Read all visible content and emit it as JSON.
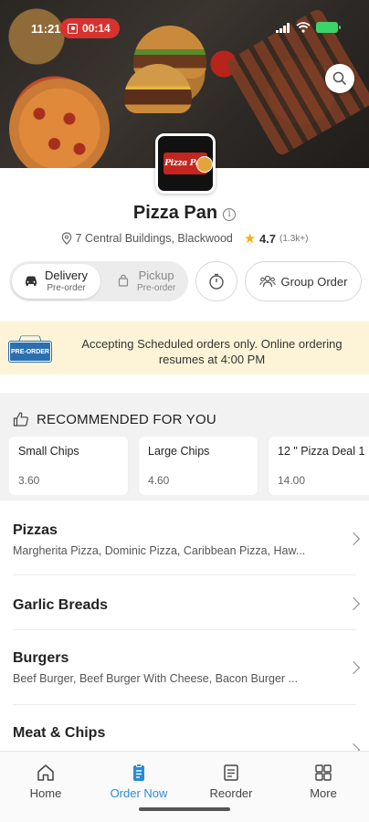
{
  "status_bar": {
    "time": "11:21",
    "recording": "00:14"
  },
  "restaurant": {
    "name": "Pizza Pan",
    "logo_text": "Pizza Pan",
    "address": "7 Central Buildings, Blackwood",
    "rating": "4.7",
    "rating_count": "(1.3k+)"
  },
  "order_mode": {
    "delivery_label": "Delivery",
    "delivery_sub": "Pre-order",
    "pickup_label": "Pickup",
    "pickup_sub": "Pre-order",
    "selected": "delivery",
    "group_order_label": "Group Order"
  },
  "banner": {
    "badge_text": "PRE-ORDER",
    "message": "Accepting Scheduled orders only. Online ordering resumes at 4:00 PM"
  },
  "recommended": {
    "title": "RECOMMENDED FOR YOU",
    "items": [
      {
        "name": "Small Chips",
        "price": "3.60"
      },
      {
        "name": "Large Chips",
        "price": "4.60"
      },
      {
        "name": "12 \" Pizza Deal 1",
        "price": "14.00"
      }
    ]
  },
  "categories": [
    {
      "name": "Pizzas",
      "desc": "Margherita Pizza, Dominic Pizza, Caribbean Pizza, Haw..."
    },
    {
      "name": "Garlic Breads",
      "desc": ""
    },
    {
      "name": "Burgers",
      "desc": "Beef Burger, Beef Burger With Cheese, Bacon Burger ..."
    },
    {
      "name": "Meat & Chips",
      "desc": ""
    }
  ],
  "bottom_nav": [
    {
      "label": "Home",
      "icon": "home-icon"
    },
    {
      "label": "Order Now",
      "icon": "order-icon",
      "active": true
    },
    {
      "label": "Reorder",
      "icon": "reorder-icon"
    },
    {
      "label": "More",
      "icon": "grid-icon"
    }
  ],
  "colors": {
    "accent": "#2b8bd6",
    "banner_bg": "#fdf4d8",
    "star": "#f3b21b",
    "recording": "#d8322e"
  }
}
